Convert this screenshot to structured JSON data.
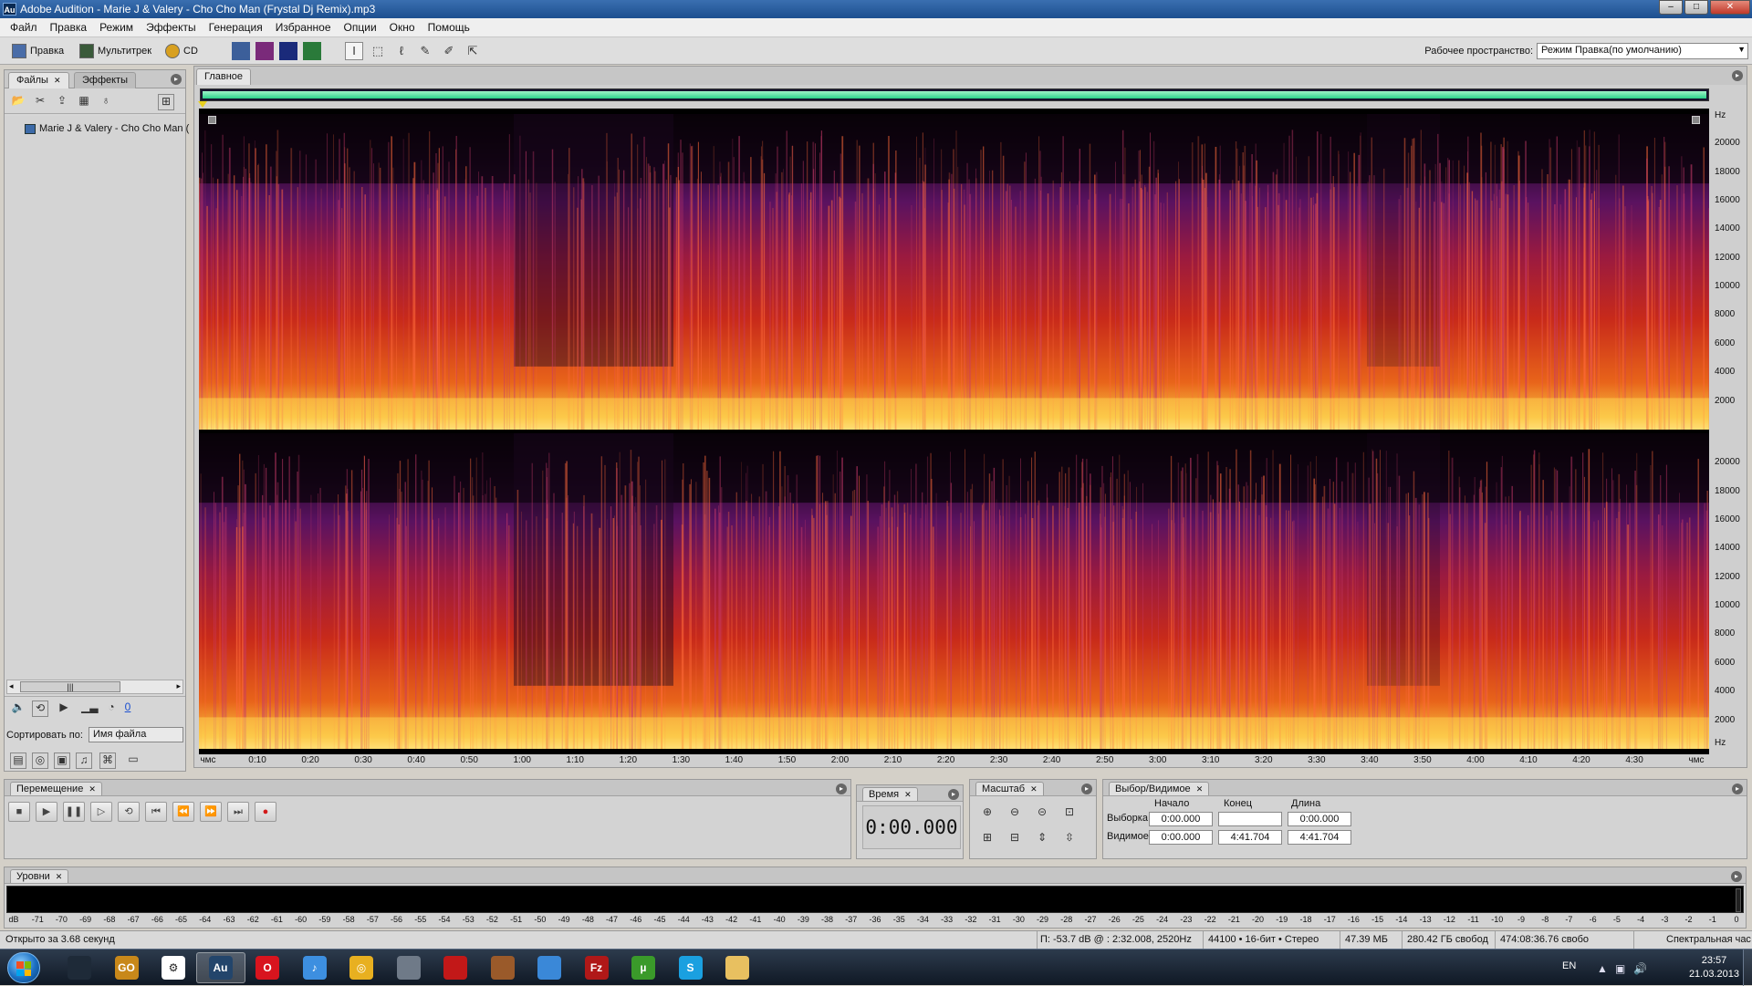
{
  "window": {
    "app_icon": "Au",
    "title": "Adobe Audition - Marie J & Valery - Cho Cho Man (Frystal Dj Remix).mp3",
    "buttons": [
      "minimize",
      "maximize",
      "close"
    ]
  },
  "menu": [
    "Файл",
    "Правка",
    "Режим",
    "Эффекты",
    "Генерация",
    "Избранное",
    "Опции",
    "Окно",
    "Помощь"
  ],
  "toolbar": {
    "edit_label": "Правка",
    "multitrack_label": "Мультитрек",
    "cd_label": "CD",
    "workspace_label": "Рабочее пространство:",
    "workspace_value": "Режим Правка(по умолчанию)"
  },
  "left_panel": {
    "tabs": [
      "Файлы",
      "Эффекты"
    ],
    "file_item": "Marie J & Valery - Cho Cho Man (",
    "volume_value": "0",
    "sort_label": "Сортировать по:",
    "sort_value": "Имя файла"
  },
  "main_panel": {
    "tab": "Главное",
    "hz_unit": "Hz",
    "hz_ticks": [
      "20000",
      "18000",
      "16000",
      "14000",
      "12000",
      "10000",
      "8000",
      "6000",
      "4000",
      "2000"
    ],
    "time_ticks": [
      "чмс",
      "0:10",
      "0:20",
      "0:30",
      "0:40",
      "0:50",
      "1:00",
      "1:10",
      "1:20",
      "1:30",
      "1:40",
      "1:50",
      "2:00",
      "2:10",
      "2:20",
      "2:30",
      "2:40",
      "2:50",
      "3:00",
      "3:10",
      "3:20",
      "3:30",
      "3:40",
      "3:50",
      "4:00",
      "4:10",
      "4:20",
      "4:30",
      "чмс"
    ]
  },
  "transport": {
    "tab": "Перемещение"
  },
  "time_panel": {
    "tab": "Время",
    "value": "0:00.000"
  },
  "zoom_panel": {
    "tab": "Масштаб"
  },
  "selection_panel": {
    "tab": "Выбор/Видимое",
    "headers": [
      "Начало",
      "Конец",
      "Длина"
    ],
    "rows": [
      {
        "label": "Выборка",
        "start": "0:00.000",
        "end": "",
        "length": "0:00.000"
      },
      {
        "label": "Видимое",
        "start": "0:00.000",
        "end": "4:41.704",
        "length": "4:41.704"
      }
    ]
  },
  "levels": {
    "tab": "Уровни",
    "scale": [
      "dB",
      "-71",
      "-70",
      "-69",
      "-68",
      "-67",
      "-66",
      "-65",
      "-64",
      "-63",
      "-62",
      "-61",
      "-60",
      "-59",
      "-58",
      "-57",
      "-56",
      "-55",
      "-54",
      "-53",
      "-52",
      "-51",
      "-50",
      "-49",
      "-48",
      "-47",
      "-46",
      "-45",
      "-44",
      "-43",
      "-42",
      "-41",
      "-40",
      "-39",
      "-38",
      "-37",
      "-36",
      "-35",
      "-34",
      "-33",
      "-32",
      "-31",
      "-30",
      "-29",
      "-28",
      "-27",
      "-26",
      "-25",
      "-24",
      "-23",
      "-22",
      "-21",
      "-20",
      "-19",
      "-18",
      "-17",
      "-16",
      "-15",
      "-14",
      "-13",
      "-12",
      "-11",
      "-10",
      "-9",
      "-8",
      "-7",
      "-6",
      "-5",
      "-4",
      "-3",
      "-2",
      "-1",
      "0"
    ]
  },
  "status": {
    "opened": "Открыто за 3.68 секунд",
    "cursor": "П: -53.7 dB @ : 2:32.008, 2520Hz",
    "format": "44100 • 16-бит • Стерео",
    "size": "47.39 МБ",
    "free": "280.42 ГБ свобод",
    "free_time": "474:08:36.76 свобо",
    "view": "Спектральная час"
  },
  "taskbar": {
    "apps": [
      {
        "name": "cs-app",
        "label": "",
        "color": "#1e2a38"
      },
      {
        "name": "csgo-app",
        "label": "GO",
        "color": "#c8881a"
      },
      {
        "name": "steam-app",
        "label": "⚙",
        "color": "#ffffff"
      },
      {
        "name": "audition-app",
        "label": "Au",
        "color": "#23456b"
      },
      {
        "name": "opera-app",
        "label": "O",
        "color": "#d8141e"
      },
      {
        "name": "itunes-app",
        "label": "♪",
        "color": "#3d8fe0"
      },
      {
        "name": "chrome-app",
        "label": "◎",
        "color": "#e8b020"
      },
      {
        "name": "game-app",
        "label": "",
        "color": "#6f7a88"
      },
      {
        "name": "nfs-app",
        "label": "",
        "color": "#c21818"
      },
      {
        "name": "warcraft-app",
        "label": "",
        "color": "#9a5a2a"
      },
      {
        "name": "app-blue",
        "label": "",
        "color": "#3a88d8"
      },
      {
        "name": "filezilla-app",
        "label": "Fz",
        "color": "#b01818"
      },
      {
        "name": "utorrent-app",
        "label": "µ",
        "color": "#3a9a2a"
      },
      {
        "name": "skype-app",
        "label": "S",
        "color": "#1aa0e0"
      },
      {
        "name": "explorer-app",
        "label": "",
        "color": "#e8c060"
      }
    ],
    "lang": "EN",
    "time": "23:57",
    "date": "21.03.2013"
  }
}
